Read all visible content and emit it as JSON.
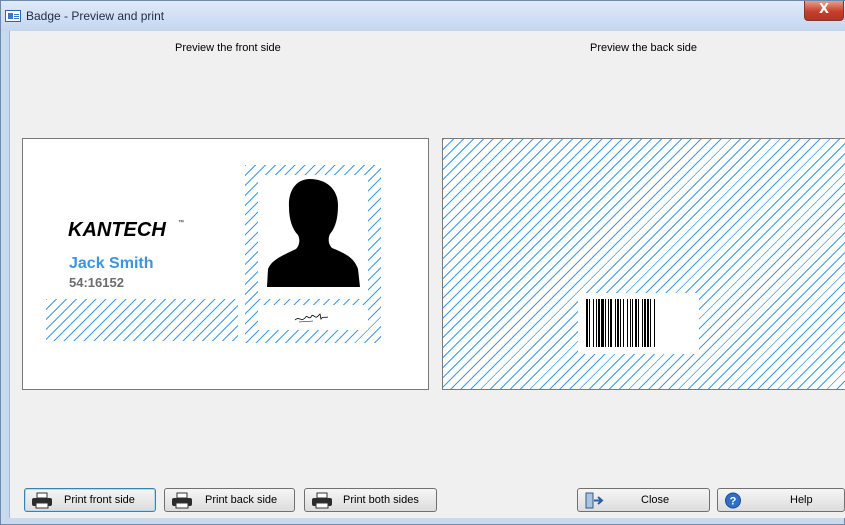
{
  "window": {
    "title": "Badge - Preview and print",
    "close_glyph": "X"
  },
  "front": {
    "label": "Preview the front side",
    "logo": "KANTECH",
    "logo_tm": "™",
    "name": "Jack Smith",
    "card_number": "54:16152"
  },
  "back": {
    "label": "Preview the back side"
  },
  "buttons": {
    "print_front": "Print front side",
    "print_back": "Print back side",
    "print_both": "Print both sides",
    "close": "Close",
    "help": "Help"
  },
  "icons": {
    "app": "badge-window-icon",
    "printer": "printer-icon",
    "close": "exit-door-icon",
    "help": "help-icon"
  },
  "colors": {
    "hatch": "#3f9be8",
    "name": "#3a95e4",
    "card_number": "#6d6d6d",
    "close_button": "#c5402b"
  }
}
